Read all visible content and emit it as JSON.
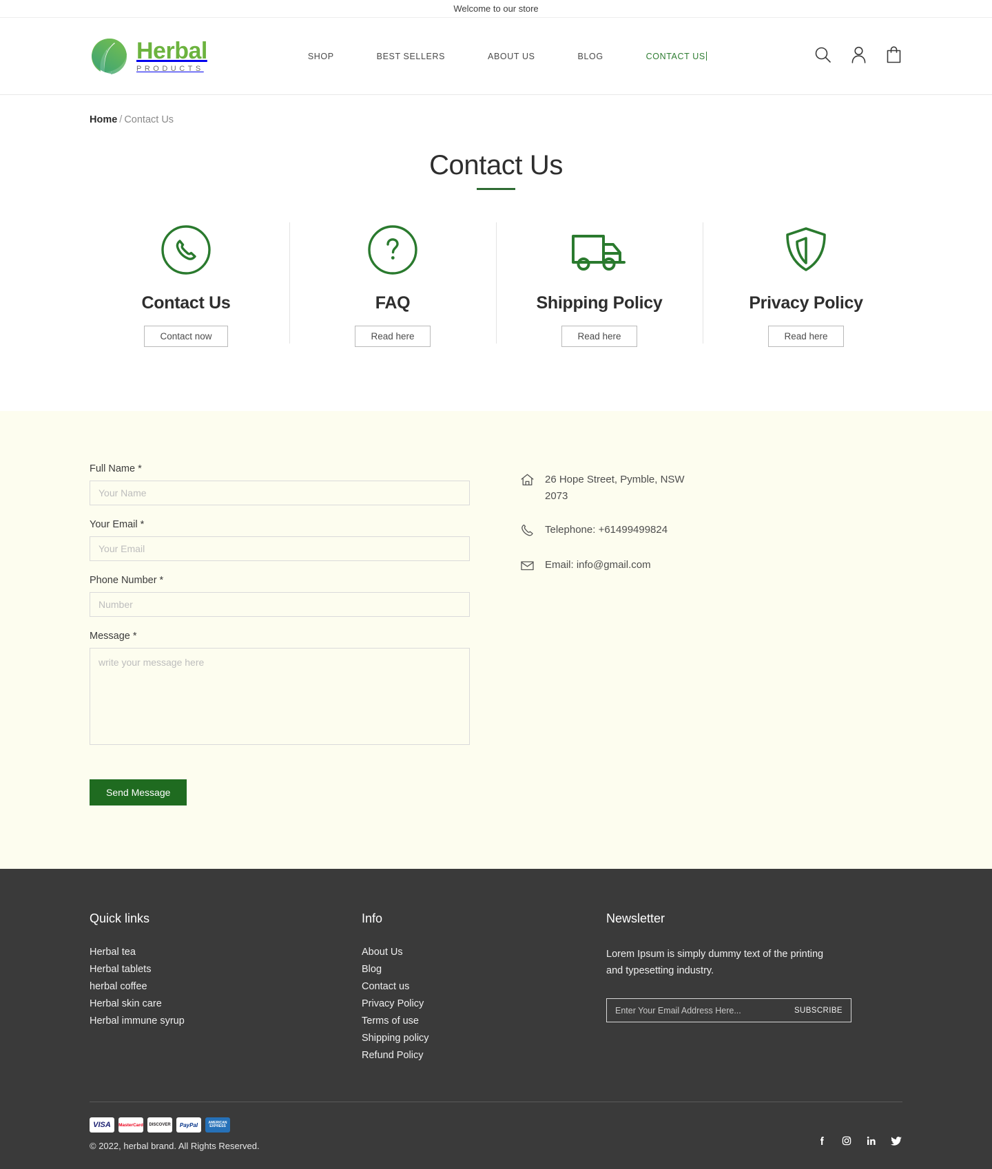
{
  "announcement": {
    "text": "Welcome to our store"
  },
  "header": {
    "logo": {
      "word": "Herbal",
      "sub": "PRODUCTS",
      "icon": "leaf-circle-icon"
    },
    "nav": [
      {
        "label": "SHOP",
        "active": false
      },
      {
        "label": "BEST SELLERS",
        "active": false
      },
      {
        "label": "ABOUT US",
        "active": false
      },
      {
        "label": "BLOG",
        "active": false
      },
      {
        "label": "CONTACT US",
        "active": true
      }
    ],
    "icons": [
      "search-icon",
      "user-account-icon",
      "shopping-bag-icon"
    ]
  },
  "breadcrumb": {
    "home": "Home",
    "separator": "/",
    "current": "Contact Us"
  },
  "page": {
    "title": "Contact Us"
  },
  "features": [
    {
      "icon": "phone-circle-icon",
      "title": "Contact Us",
      "button": "Contact now"
    },
    {
      "icon": "question-circle-icon",
      "title": "FAQ",
      "button": "Read  here"
    },
    {
      "icon": "delivery-truck-icon",
      "title": "Shipping Policy",
      "button": "Read  here"
    },
    {
      "icon": "shield-icon",
      "title": "Privacy Policy",
      "button": "Read  here"
    }
  ],
  "form": {
    "fields": [
      {
        "label": "Full Name *",
        "placeholder": "Your Name",
        "value": "",
        "type": "text"
      },
      {
        "label": "Your Email *",
        "placeholder": "Your Email",
        "value": "",
        "type": "email"
      },
      {
        "label": "Phone Number *",
        "placeholder": "Number",
        "value": "",
        "type": "tel"
      }
    ],
    "message": {
      "label": "Message *",
      "placeholder": "write your message here",
      "value": ""
    },
    "submit": "Send Message"
  },
  "contact_info": [
    {
      "icon": "home-icon",
      "text": "26 Hope Street, Pymble, NSW 2073"
    },
    {
      "icon": "phone-icon",
      "text": "Telephone: +61499499824"
    },
    {
      "icon": "envelope-icon",
      "text": "Email: info@gmail.com"
    }
  ],
  "footer": {
    "quick_links": {
      "title": "Quick links",
      "items": [
        "Herbal tea",
        "Herbal  tablets",
        "herbal coffee",
        "Herbal skin care",
        "Herbal immune syrup"
      ]
    },
    "info": {
      "title": "Info",
      "items": [
        "About Us",
        "Blog",
        "Contact us",
        "Privacy Policy",
        "Terms of use",
        "Shipping policy",
        "Refund Policy"
      ]
    },
    "newsletter": {
      "title": "Newsletter",
      "text": "Lorem Ipsum is simply dummy text of the printing and typesetting industry.",
      "placeholder": "Enter Your Email Address Here...",
      "value": "",
      "button": "SUBSCRIBE"
    },
    "payments": [
      "VISA",
      "MasterCard",
      "DISCOVER",
      "PayPal",
      "AMERICAN EXPRESS"
    ],
    "copyright": "© 2022, herbal brand. All Rights Reserved.",
    "socials": [
      "facebook-icon",
      "instagram-icon",
      "linkedin-icon",
      "twitter-icon"
    ]
  },
  "colors": {
    "brand_green": "#6cb33f",
    "accent_green": "#2e6b33",
    "footer_bg": "#3a3a3a",
    "form_bg": "#fdfdef"
  }
}
